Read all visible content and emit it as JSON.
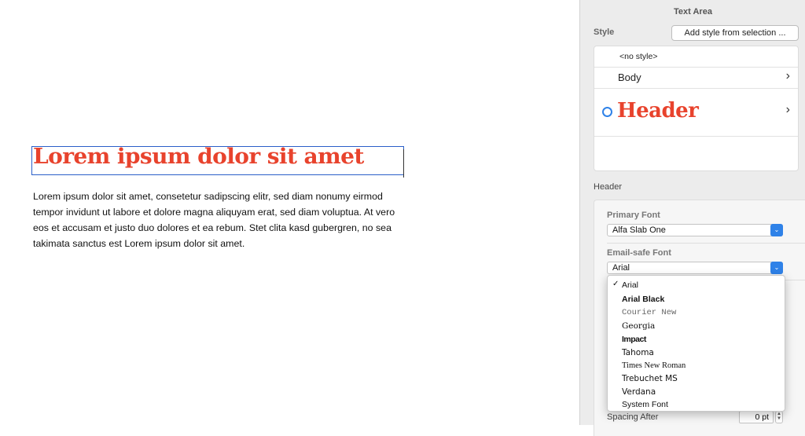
{
  "canvas": {
    "headline": "Lorem ipsum dolor sit amet",
    "paragraph": "Lorem ipsum dolor sit amet, consetetur sadipscing elitr, sed diam nonumy eirmod tempor invidunt ut labore et dolore magna aliquyam erat, sed diam voluptua. At vero eos et accusam et justo duo dolores et ea rebum. Stet clita kasd gubergren, no sea takimata sanctus est Lorem ipsum dolor sit amet."
  },
  "panel": {
    "title": "Text Area",
    "style_label": "Style",
    "add_style_button": "Add style from selection ...",
    "styles": [
      {
        "label": "<no style>"
      },
      {
        "label": "Body",
        "chevron": "›"
      },
      {
        "label": "Header",
        "chevron": "›",
        "selected": true
      }
    ],
    "section_label": "Header",
    "primary_font_label": "Primary Font",
    "primary_font_value": "Alfa Slab One",
    "email_font_label": "Email-safe Font",
    "email_font_value": "Arial",
    "spacing_after_label": "Spacing After",
    "spacing_after_value": "0 pt",
    "select_arrow": "⌄",
    "stepper_up": "▲",
    "stepper_down": "▼"
  },
  "dropdown": {
    "check": "✓",
    "items": [
      {
        "label": "Arial",
        "checked": true
      },
      {
        "label": "Arial Black"
      },
      {
        "label": "Courier New"
      },
      {
        "label": "Georgia"
      },
      {
        "label": "Impact"
      },
      {
        "label": "Tahoma"
      },
      {
        "label": "Times New Roman"
      },
      {
        "label": "Trebuchet MS"
      },
      {
        "label": "Verdana"
      },
      {
        "label": "System Font"
      }
    ]
  },
  "colors": {
    "accent": "#2f82e8",
    "header_red": "#e8432d",
    "selection_border": "#2a5fc9"
  }
}
